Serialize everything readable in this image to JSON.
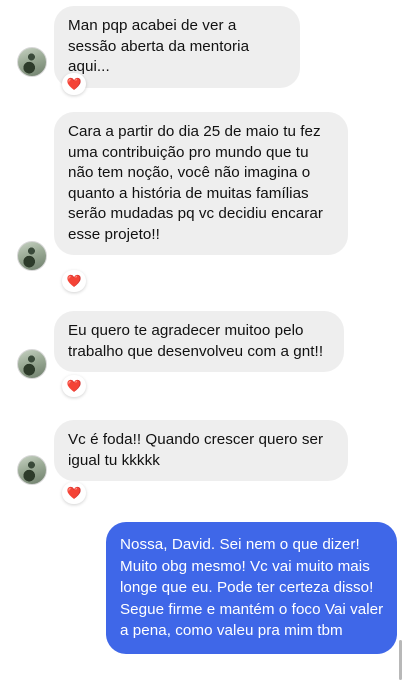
{
  "messages": [
    {
      "text": "Man pqp acabei de ver a sessão aberta da mentoria aqui...",
      "reaction": "❤️"
    },
    {
      "text": "Cara a partir do dia 25 de maio tu fez uma contribuição pro mundo que tu não tem noção, você não imagina o quanto a história de muitas famílias serão mudadas pq vc decidiu encarar esse projeto!!",
      "reaction": "❤️"
    },
    {
      "text": "Eu quero te agradecer muitoo pelo trabalho que desenvolveu com a gnt!!",
      "reaction": "❤️"
    },
    {
      "text": "Vc é foda!! Quando crescer quero ser igual tu kkkkk",
      "reaction": "❤️"
    },
    {
      "text": "Nossa, David. Sei nem o que dizer! Muito obg mesmo! Vc vai muito mais longe que eu. Pode ter certeza disso! Segue firme e mantém o foco Vai valer a pena, como valeu pra mim tbm"
    }
  ],
  "colors": {
    "incoming_bubble": "#eeeeee",
    "outgoing_bubble": "#3f67e8",
    "reaction_heart": "#e0245e"
  }
}
